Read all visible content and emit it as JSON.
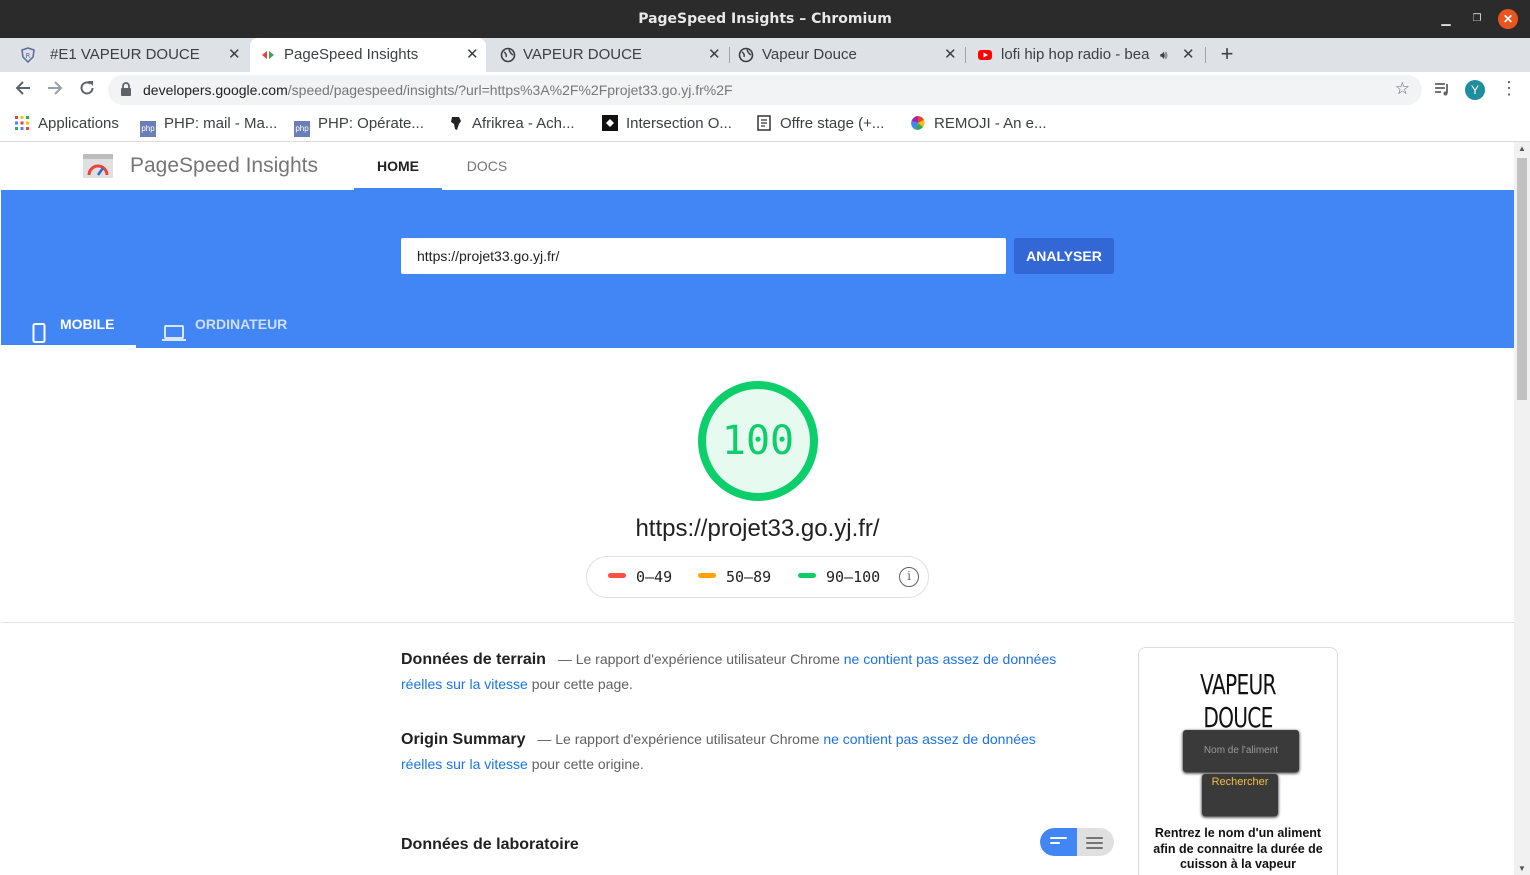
{
  "window": {
    "title": "PageSpeed Insights – Chromium"
  },
  "tabs": [
    {
      "label": "#E1 VAPEUR DOUCE",
      "icon": "shield-icon"
    },
    {
      "label": "PageSpeed Insights",
      "icon": "pagespeed-icon"
    },
    {
      "label": "VAPEUR DOUCE",
      "icon": "globe-icon"
    },
    {
      "label": "Vapeur Douce",
      "icon": "globe-icon"
    },
    {
      "label": "lofi hip hop radio - bea",
      "icon": "youtube-icon"
    }
  ],
  "toolbar": {
    "url_host": "developers.google.com",
    "url_path": "/speed/pagespeed/insights/?url=https%3A%2F%2Fprojet33.go.yj.fr%2F",
    "profile_initial": "Y"
  },
  "bookmarks": [
    "Applications",
    "PHP: mail - Ma...",
    "PHP: Opérate...",
    "Afrikrea - Ach...",
    "Intersection O...",
    "Offre stage (+...",
    "REMOJI - An e..."
  ],
  "psi": {
    "brand": "PageSpeed Insights",
    "nav": {
      "home": "HOME",
      "docs": "DOCS"
    },
    "url_input": "https://projet33.go.yj.fr/",
    "analyse_label": "ANALYSER",
    "device_tabs": {
      "mobile": "MOBILE",
      "desktop": "ORDINATEUR"
    },
    "score": "100",
    "score_fraction": 1.0,
    "report_url": "https://projet33.go.yj.fr/",
    "legend": {
      "low": "0–49",
      "mid": "50–89",
      "high": "90–100"
    },
    "colors": {
      "accent": "#4285f4",
      "pass": "#0cce6b",
      "average": "#ffa400",
      "fail": "#ff4e42"
    },
    "field": {
      "title": "Données de terrain",
      "prefix": "— Le rapport d'expérience utilisateur Chrome",
      "link": "ne contient pas assez de données réelles sur la vitesse",
      "suffix": "pour cette page."
    },
    "origin": {
      "title": "Origin Summary",
      "prefix": "— Le rapport d'expérience utilisateur Chrome",
      "link": "ne contient pas assez de données réelles sur la vitesse",
      "suffix": "pour cette origine."
    },
    "lab_title": "Données de laboratoire",
    "thumbnail": {
      "title": "VAPEUR DOUCE",
      "input_placeholder": "Nom de l'aliment",
      "button": "Rechercher",
      "text": "Rentrez le nom d'un aliment afin de connaitre la durée de cuisson à la vapeur"
    }
  }
}
